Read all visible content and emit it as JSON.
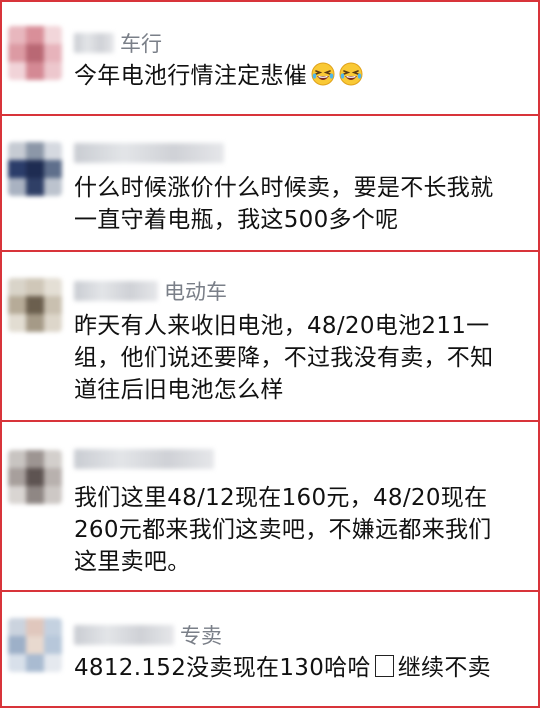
{
  "comments": [
    {
      "name_suffix": "车行",
      "text": "今年电池行情注定悲催"
    },
    {
      "name_suffix": "",
      "text": "什么时候涨价什么时候卖，要是不长我就一直守着电瓶，我这500多个呢"
    },
    {
      "name_suffix": "电动车",
      "text": "昨天有人来收旧电池，48/20电池211一组，他们说还要降，不过我没有卖，不知道往后旧电池怎么样"
    },
    {
      "name_suffix": "",
      "text": "我们这里48/12现在160元，48/20现在260元都来我们这卖吧，不嫌远都来我们这里卖吧。"
    },
    {
      "name_suffix": "专卖",
      "text_part1": "4812.152没卖现在130哈哈",
      "text_part2": "继续不卖"
    }
  ],
  "emojis": [
    "laughing-crying-emoji",
    "laughing-crying-emoji"
  ],
  "colors": {
    "accent_border": "#d8343a",
    "name_gray": "#7a7f88",
    "text": "#111111"
  }
}
